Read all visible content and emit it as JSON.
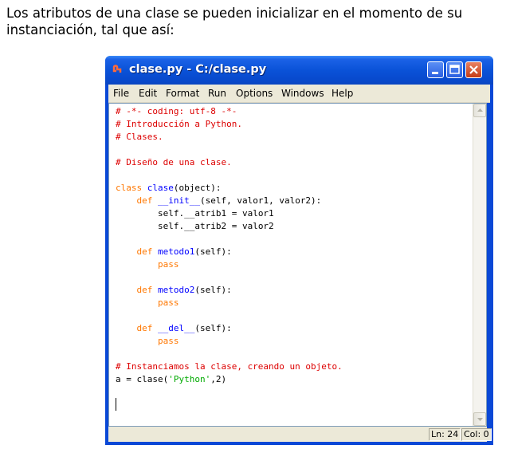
{
  "intro": {
    "line1": "Los atributos de una clase se pueden inicializar en el momento de su",
    "line2": "instanciación, tal que así:"
  },
  "window": {
    "title": "clase.py - C:/clase.py",
    "menu": [
      "File",
      "Edit",
      "Format",
      "Run",
      "Options",
      "Windows",
      "Help"
    ],
    "status": {
      "line": "Ln: 24",
      "col": "Col: 0"
    },
    "colors": {
      "comment": "#dd0000",
      "keyword": "#ff7700",
      "definition": "#0000ff",
      "string": "#00aa00",
      "titlebar": "#0a52d8"
    }
  },
  "code": {
    "l1": "# -*- coding: utf-8 -*-",
    "l2": "# Introducción a Python.",
    "l3": "# Clases.",
    "l5": "# Diseño de una clase.",
    "kw_class": "class",
    "class_name": "clase",
    "class_rest": "(object):",
    "kw_def": "def",
    "init_name": "__init__",
    "init_rest": "(self, valor1, valor2):",
    "l8": "self.__atrib1 = valor1",
    "l9": "self.__atrib2 = valor2",
    "m1_name": "metodo1",
    "m2_name": "metodo2",
    "del_name": "__del__",
    "self_sig": "(self):",
    "kw_pass": "pass",
    "l21": "# Instanciamos la clase, creando un objeto.",
    "l22_a": "a = clase(",
    "l22_str": "'Python'",
    "l22_b": ",2)"
  }
}
